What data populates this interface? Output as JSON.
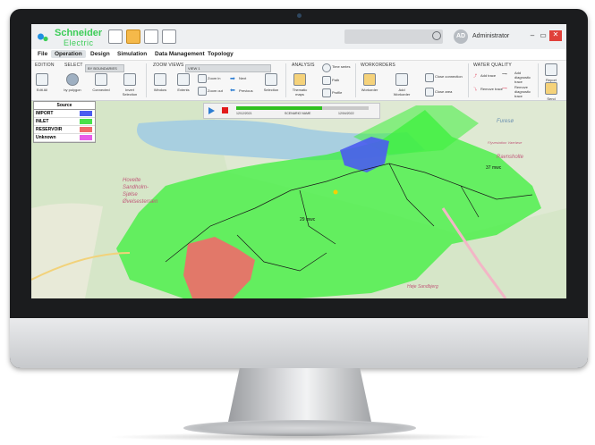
{
  "app": {
    "brand_name": "Schneider",
    "brand_sub": "Electric",
    "user_initials": "AD",
    "user_name": "Administrator",
    "win_min": "–",
    "win_max": "▭",
    "win_close": "✕"
  },
  "menu": [
    "File",
    "Operation",
    "Design",
    "Simulation",
    "Data Management",
    "Topology"
  ],
  "ribbon": {
    "edition": "EDITION",
    "select": "SELECT",
    "select_value": "BY BOUNDARIES",
    "zoom_views": "ZOOM VIEWS",
    "zoom_value": "VIEW 1",
    "analysis": "ANALYSIS",
    "workorders": "WORKORDERS",
    "water_quality": "WATER QUALITY",
    "buttons": {
      "edit_all": "Edit All",
      "by_polygon": "by polygon",
      "connected": "Connected",
      "invert_selection": "Invert Selection",
      "window": "Window",
      "extents": "Extents",
      "zoom_in": "Zoom in",
      "zoom_out": "Zoom out",
      "next": "Next",
      "previous": "Previous",
      "selection": "Selection",
      "thematic_maps": "Thematic maps",
      "time_series": "Time series",
      "path": "Path",
      "profile": "Profile",
      "workorder": "Workorder",
      "add_workorder": "Add Workorder",
      "close_connection": "Close connection",
      "close_area": "Close area",
      "add_trace": "Add trace",
      "remove_trace": "Remove trace",
      "add_diagnostic": "Add diagnostic trace",
      "remove_diagnostic": "Remove diagnostic trace",
      "report": "Report",
      "send": "Send"
    }
  },
  "legend": {
    "title": "Source",
    "items": [
      {
        "label": "IMPORT",
        "color": "#4a5cf0"
      },
      {
        "label": "INLET",
        "color": "#48e24a"
      },
      {
        "label": "RESERVOIR",
        "color": "#f06a6a"
      },
      {
        "label": "Unknown",
        "color": "#e75be7"
      }
    ]
  },
  "player": {
    "start_date": "12/12/2021",
    "scenario": "SCENARIO NAME",
    "end_date": "12/04/2022",
    "progress": 0.65
  },
  "map": {
    "labels": [
      "Hovelte",
      "Sandholm-",
      "Sjølse",
      "Øvelsesterræn",
      "Furesø",
      "Ravnsholte",
      "Flyvestation Vaerløse",
      "Høje Sandbjerg"
    ],
    "pressure_labels": [
      "29 mwc",
      "37 mwc"
    ]
  },
  "colors": {
    "accent": "#3dcd58",
    "inlet": "#48e24a",
    "import": "#4a5cf0",
    "reservoir": "#f06a6a"
  }
}
